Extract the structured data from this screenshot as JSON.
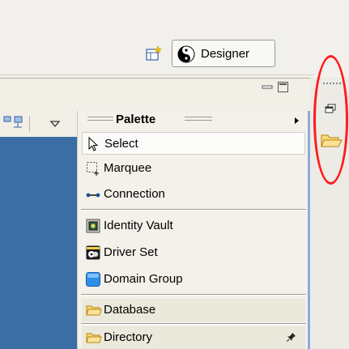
{
  "toolbar": {
    "perspective_button_label": "Designer"
  },
  "palette": {
    "title": "Palette",
    "tools": [
      {
        "label": "Select",
        "icon": "arrow-cursor-icon"
      },
      {
        "label": "Marquee",
        "icon": "marquee-icon"
      },
      {
        "label": "Connection",
        "icon": "connection-icon"
      }
    ],
    "elements": [
      {
        "label": "Identity Vault",
        "icon": "identity-vault-icon"
      },
      {
        "label": "Driver Set",
        "icon": "driver-set-icon"
      },
      {
        "label": "Domain Group",
        "icon": "domain-group-icon"
      }
    ],
    "drawers": [
      {
        "label": "Database",
        "icon": "folder-icon"
      },
      {
        "label": "Directory",
        "icon": "folder-icon",
        "pinned": true
      }
    ]
  },
  "colors": {
    "canvas": "#3a6ea5",
    "annotation": "#ff1a1a",
    "palette_border": "#8faadc"
  }
}
